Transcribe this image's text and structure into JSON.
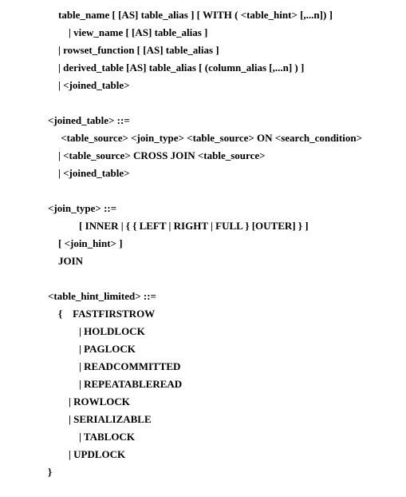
{
  "lines": [
    "    table_name [ [AS] table_alias ] [ WITH ( <table_hint> [,...n]) ]",
    "        | view_name [ [AS] table_alias ]",
    "    | rowset_function [ [AS] table_alias ]",
    "    | derived_table [AS] table_alias [ (column_alias [,...n] ) ]",
    "    | <joined_table>",
    "",
    "<joined_table> ::=",
    "     <table_source> <join_type> <table_source> ON <search_condition>",
    "    | <table_source> CROSS JOIN <table_source>",
    "    | <joined_table>",
    "",
    "<join_type> ::=",
    "            [ INNER | { { LEFT | RIGHT | FULL } [OUTER] } ]",
    "    [ <join_hint> ]",
    "    JOIN",
    "",
    "<table_hint_limited> ::=",
    "    {    FASTFIRSTROW",
    "            | HOLDLOCK",
    "            | PAGLOCK",
    "            | READCOMMITTED",
    "            | REPEATABLEREAD",
    "        | ROWLOCK",
    "        | SERIALIZABLE",
    "            | TABLOCK",
    "        | UPDLOCK",
    "}"
  ]
}
